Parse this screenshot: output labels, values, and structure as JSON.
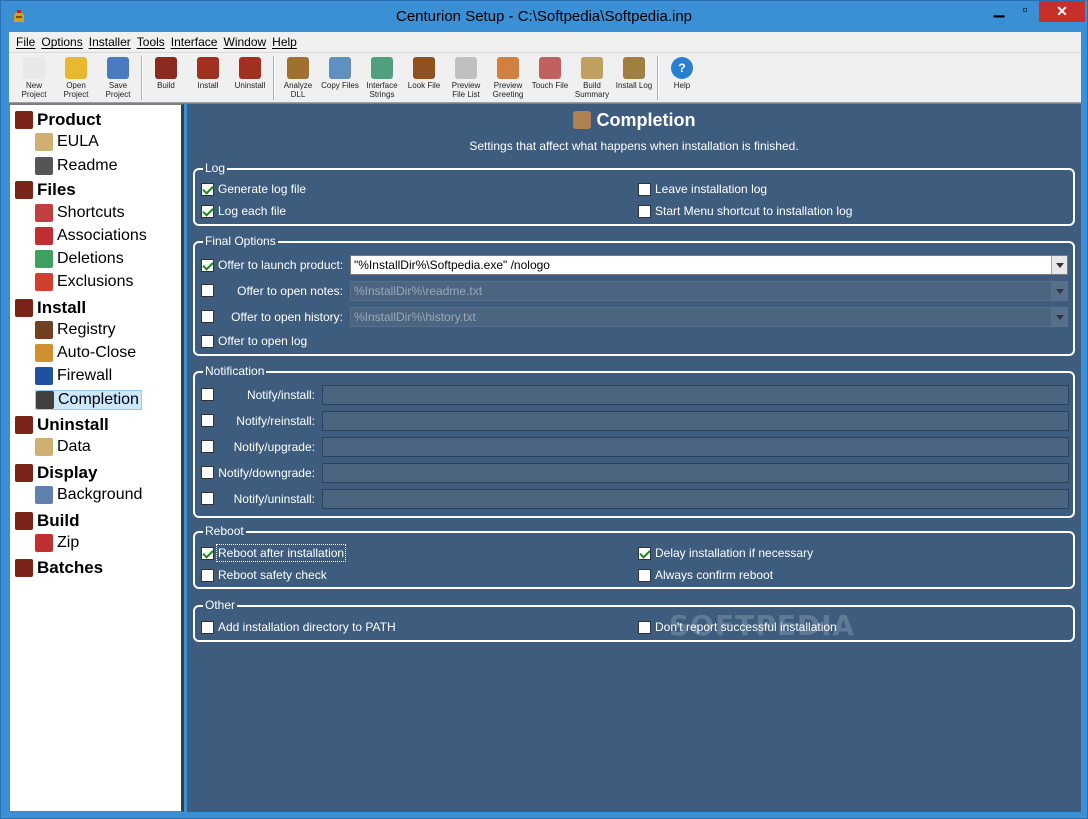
{
  "window": {
    "title": "Centurion Setup - C:\\Softpedia\\Softpedia.inp"
  },
  "menu": [
    "File",
    "Options",
    "Installer",
    "Tools",
    "Interface",
    "Window",
    "Help"
  ],
  "toolbar": [
    {
      "label": "New Project",
      "icon": "new-project-icon"
    },
    {
      "label": "Open Project",
      "icon": "open-folder-icon"
    },
    {
      "label": "Save Project",
      "icon": "save-disk-icon"
    },
    {
      "label": "Build",
      "icon": "build-icon"
    },
    {
      "label": "Install",
      "icon": "install-icon"
    },
    {
      "label": "Uninstall",
      "icon": "uninstall-icon"
    },
    {
      "label": "Analyze DLL",
      "icon": "analyze-dll-icon"
    },
    {
      "label": "Copy Files",
      "icon": "copy-files-icon"
    },
    {
      "label": "Interface Strings",
      "icon": "interface-strings-icon"
    },
    {
      "label": "Look File",
      "icon": "look-file-icon"
    },
    {
      "label": "Preview File List",
      "icon": "preview-file-list-icon"
    },
    {
      "label": "Preview Greeting",
      "icon": "preview-greeting-icon"
    },
    {
      "label": "Touch File",
      "icon": "touch-file-icon"
    },
    {
      "label": "Build Summary",
      "icon": "build-summary-icon"
    },
    {
      "label": "Install Log",
      "icon": "install-log-icon"
    },
    {
      "label": "Help",
      "icon": "help-icon"
    }
  ],
  "tree": [
    {
      "label": "Product",
      "level": 0,
      "icon": "product-icon"
    },
    {
      "label": "EULA",
      "level": 1,
      "icon": "eula-icon"
    },
    {
      "label": "Readme",
      "level": 1,
      "icon": "readme-icon"
    },
    {
      "label": "Files",
      "level": 0,
      "icon": "files-icon"
    },
    {
      "label": "Shortcuts",
      "level": 1,
      "icon": "shortcuts-icon"
    },
    {
      "label": "Associations",
      "level": 1,
      "icon": "associations-icon"
    },
    {
      "label": "Deletions",
      "level": 1,
      "icon": "deletions-icon"
    },
    {
      "label": "Exclusions",
      "level": 1,
      "icon": "exclusions-icon"
    },
    {
      "label": "Install",
      "level": 0,
      "icon": "install-icon"
    },
    {
      "label": "Registry",
      "level": 1,
      "icon": "registry-icon"
    },
    {
      "label": "Auto-Close",
      "level": 1,
      "icon": "auto-close-icon"
    },
    {
      "label": "Firewall",
      "level": 1,
      "icon": "firewall-icon"
    },
    {
      "label": "Completion",
      "level": 1,
      "icon": "completion-icon",
      "selected": true
    },
    {
      "label": "Uninstall",
      "level": 0,
      "icon": "uninstall-icon"
    },
    {
      "label": "Data",
      "level": 1,
      "icon": "data-icon"
    },
    {
      "label": "Display",
      "level": 0,
      "icon": "display-icon"
    },
    {
      "label": "Background",
      "level": 1,
      "icon": "background-icon"
    },
    {
      "label": "Build",
      "level": 0,
      "icon": "build-icon"
    },
    {
      "label": "Zip",
      "level": 1,
      "icon": "zip-icon"
    },
    {
      "label": "Batches",
      "level": 0,
      "icon": "batches-icon"
    }
  ],
  "page": {
    "title": "Completion",
    "subtitle": "Settings that affect what happens when installation is finished."
  },
  "log": {
    "label": "Log",
    "generate_log_file": {
      "label": "Generate log file",
      "checked": true
    },
    "log_each_file": {
      "label": "Log each file",
      "checked": true
    },
    "leave_installation_log": {
      "label": "Leave installation log",
      "checked": false
    },
    "start_menu_shortcut": {
      "label": "Start Menu shortcut to installation log",
      "checked": false
    }
  },
  "final_options": {
    "label": "Final Options",
    "launch_product": {
      "label": "Offer to launch product:",
      "checked": true,
      "value": "\"%InstallDir%\\Softpedia.exe\" /nologo"
    },
    "open_notes": {
      "label": "Offer to open notes:",
      "checked": false,
      "value": "%InstallDir%\\readme.txt"
    },
    "open_history": {
      "label": "Offer to open history:",
      "checked": false,
      "value": "%InstallDir%\\history.txt"
    },
    "open_log": {
      "label": "Offer to open log",
      "checked": false
    }
  },
  "notification": {
    "label": "Notification",
    "items": [
      {
        "label": "Notify/install:",
        "checked": false,
        "value": ""
      },
      {
        "label": "Notify/reinstall:",
        "checked": false,
        "value": ""
      },
      {
        "label": "Notify/upgrade:",
        "checked": false,
        "value": ""
      },
      {
        "label": "Notify/downgrade:",
        "checked": false,
        "value": ""
      },
      {
        "label": "Notify/uninstall:",
        "checked": false,
        "value": ""
      }
    ]
  },
  "reboot": {
    "label": "Reboot",
    "after_installation": {
      "label": "Reboot after installation",
      "checked": true
    },
    "safety_check": {
      "label": "Reboot safety check",
      "checked": false
    },
    "delay_installation": {
      "label": "Delay installation if necessary",
      "checked": true
    },
    "always_confirm": {
      "label": "Always confirm reboot",
      "checked": false
    }
  },
  "other": {
    "label": "Other",
    "add_to_path": {
      "label": "Add installation directory to PATH",
      "checked": false
    },
    "dont_report": {
      "label": "Don't report successful installation",
      "checked": false
    }
  },
  "watermark": "SOFTPEDIA",
  "colors": {
    "panel_bg": "#3d5c7e",
    "window_frame": "#3b8fd4",
    "check_mark": "#1a8a1a",
    "close_button": "#c7302a"
  }
}
